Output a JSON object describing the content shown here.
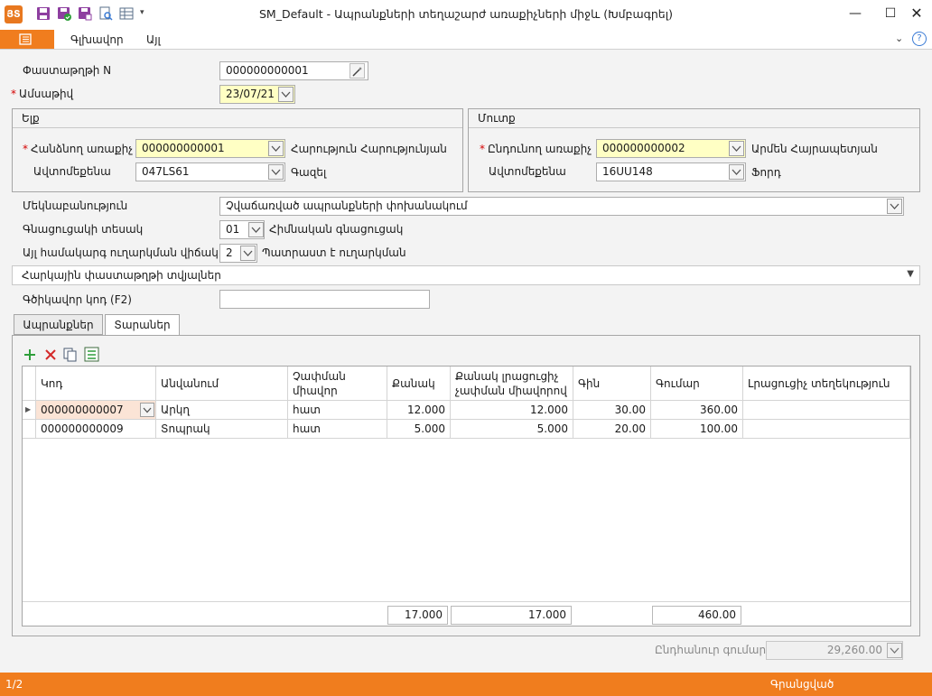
{
  "window": {
    "title": "SM_Default - Ապրանքների տեղաշարժ առաքիչների միջև (Խմբագրել)",
    "logo": "ՅՏ"
  },
  "ribbon": {
    "tabs": [
      "Գլխավոր",
      "Այլ"
    ]
  },
  "form": {
    "doc_no_label": "Փաստաթղթի N",
    "doc_no_value": "000000000001",
    "date_label": "Ամսաթիվ",
    "date_value": "23/07/21",
    "out_group": {
      "title": "Ելք",
      "sender_label": "Հանձնող առաքիչ",
      "sender_code": "000000000001",
      "sender_name": "Հարություն Հարությունյան",
      "vehicle_label": "Ավտոմեքենա",
      "vehicle_value": "047LS61",
      "vehicle_name": "Գազել"
    },
    "in_group": {
      "title": "Մուտք",
      "receiver_label": "Ընդունող առաքիչ",
      "receiver_code": "000000000002",
      "receiver_name": "Արմեն Հայրապետյան",
      "vehicle_label": "Ավտոմեքենա",
      "vehicle_value": "16UU148",
      "vehicle_name": "Ֆորդ"
    },
    "comment_label": "Մեկնաբանություն",
    "comment_value": "Չվաճառված ապրանքների փոխանակում",
    "pricelist_label": "Գնացուցակի տեսակ",
    "pricelist_code": "01",
    "pricelist_name": "Հիմնական գնացուցակ",
    "sendstate_label": "Այլ համակարգ ուղարկման վիճակ",
    "sendstate_code": "2",
    "sendstate_name": "Պատրաստ է ուղարկման",
    "tax_section": "Հարկային փաստաթղթի տվյալներ",
    "barcode_label": "Գծիկավոր կոդ (F2)",
    "barcode_value": ""
  },
  "tabs": [
    "Ապրանքներ",
    "Տարաներ"
  ],
  "grid": {
    "columns": [
      "Կոդ",
      "Անվանում",
      "Չափման միավոր",
      "Քանակ",
      "Քանակ լրացուցիչ չափման միավորով",
      "Գին",
      "Գումար",
      "Լրացուցիչ տեղեկություն"
    ],
    "rows": [
      {
        "code": "000000000007",
        "name": "Արկղ",
        "unit": "հատ",
        "qty": "12.000",
        "qty_extra": "12.000",
        "price": "30.00",
        "sum": "360.00",
        "info": ""
      },
      {
        "code": "000000000009",
        "name": "Տոպրակ",
        "unit": "հատ",
        "qty": "5.000",
        "qty_extra": "5.000",
        "price": "20.00",
        "sum": "100.00",
        "info": ""
      }
    ],
    "totals": {
      "qty": "17.000",
      "qty_extra": "17.000",
      "sum": "460.00"
    }
  },
  "total": {
    "label": "Ընդհանուր գումար",
    "value": "29,260.00"
  },
  "status": {
    "page": "1/2",
    "state": "Գրանցված"
  },
  "colors": {
    "accent": "#f07d1e",
    "required": "#d40000",
    "highlight": "#ffffc4"
  }
}
